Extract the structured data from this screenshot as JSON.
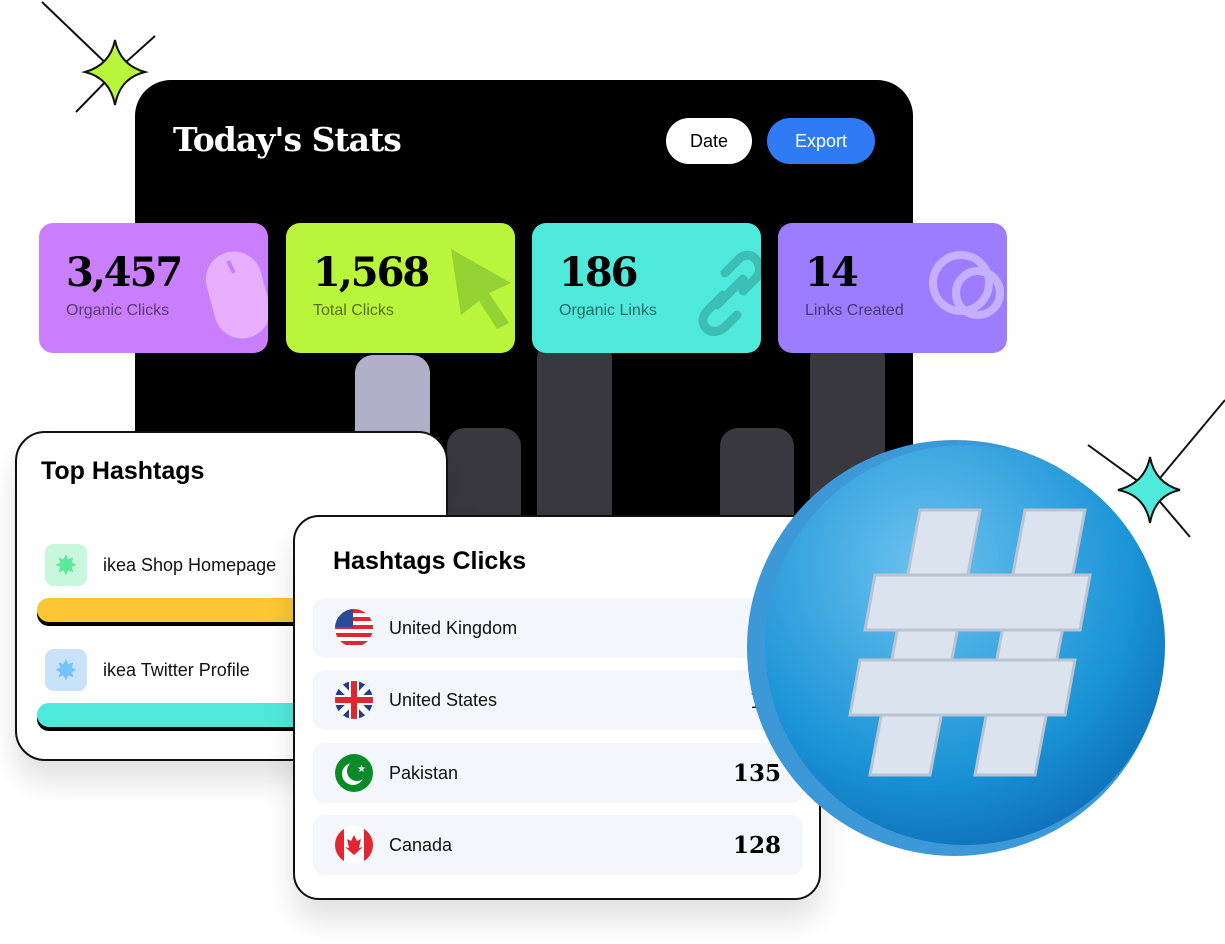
{
  "header": {
    "title": "Today's Stats",
    "date_label": "Date",
    "export_label": "Export"
  },
  "stats": [
    {
      "value": "3,457",
      "label": "Organic Clicks",
      "color": "#c97efc",
      "icon": "mouse-icon"
    },
    {
      "value": "1,568",
      "label": "Total Clicks",
      "color": "#b9f63b",
      "icon": "cursor-icon"
    },
    {
      "value": "186",
      "label": "Organic Links",
      "color": "#4fe9dc",
      "icon": "link-icon"
    },
    {
      "value": "14",
      "label": "Links Created",
      "color": "#9e7cff",
      "icon": "link-loop-icon"
    }
  ],
  "top_hashtags": {
    "title": "Top Hashtags",
    "items": [
      {
        "label": "ikea Shop Homepage",
        "color": "#fcc634"
      },
      {
        "label": "ikea Twitter Profile",
        "color": "#4fe9dc"
      }
    ]
  },
  "hashtag_clicks": {
    "title": "Hashtags Clicks",
    "rows": [
      {
        "country": "United Kingdom",
        "flag": "us-flag-icon"
      },
      {
        "country": "United States",
        "value": "14",
        "flag": "uk-flag-icon"
      },
      {
        "country": "Pakistan",
        "value": "135",
        "flag": "pakistan-flag-icon"
      },
      {
        "country": "Canada",
        "value": "128",
        "flag": "canada-flag-icon"
      }
    ]
  }
}
